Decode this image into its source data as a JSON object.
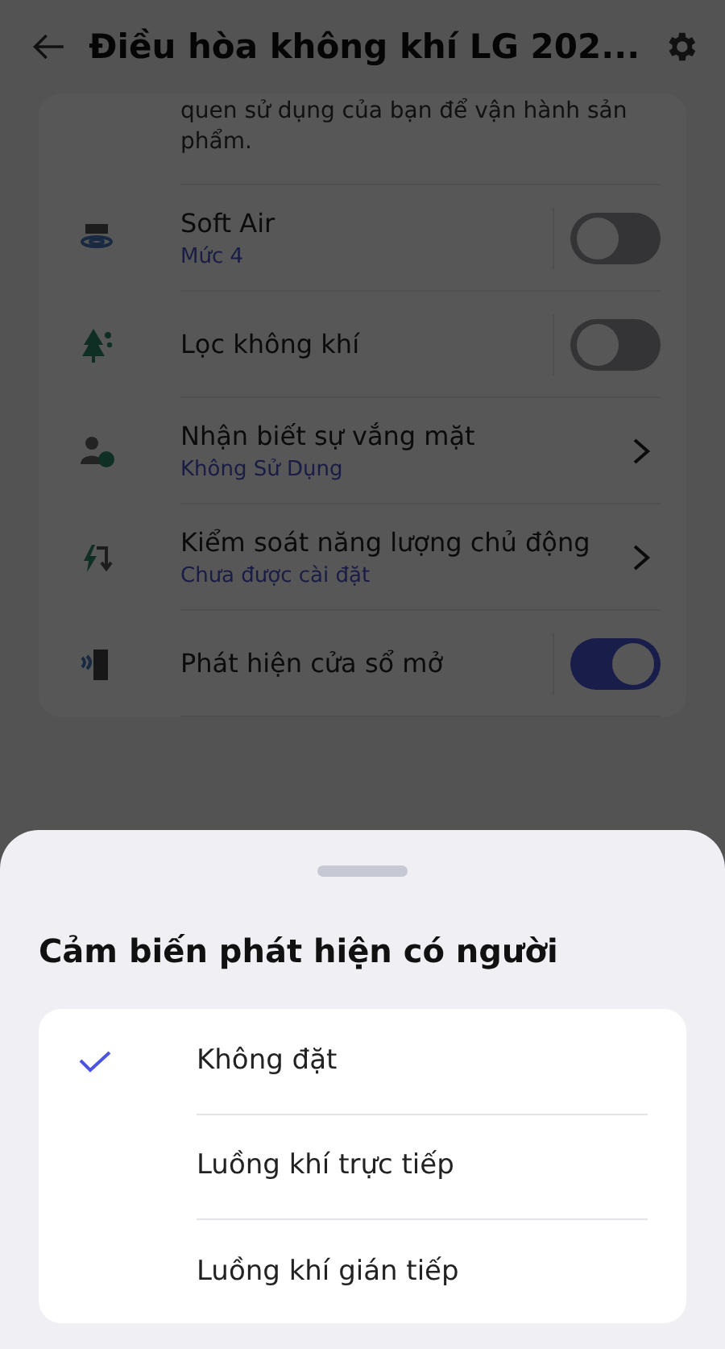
{
  "header": {
    "title": "Điều hòa không khí LG 202..."
  },
  "intro": {
    "description": "quen sử dụng của bạn để vận hành sản phẩm."
  },
  "settings": [
    {
      "kind": "toggle",
      "label": "Soft Air",
      "sub": "Mức 4",
      "on": false
    },
    {
      "kind": "toggle",
      "label": "Lọc không khí",
      "on": false
    },
    {
      "kind": "link",
      "label": "Nhận biết sự vắng mặt",
      "sub": "Không Sử Dụng"
    },
    {
      "kind": "link",
      "label": "Kiểm soát năng lượng chủ động",
      "sub": "Chưa được cài đặt"
    },
    {
      "kind": "toggle",
      "label": "Phát hiện cửa sổ mở",
      "on": true
    }
  ],
  "sheet": {
    "title": "Cảm biến phát hiện có người",
    "options": [
      {
        "label": "Không đặt",
        "selected": true
      },
      {
        "label": "Luồng khí trực tiếp",
        "selected": false
      },
      {
        "label": "Luồng khí gián tiếp",
        "selected": false
      }
    ]
  }
}
